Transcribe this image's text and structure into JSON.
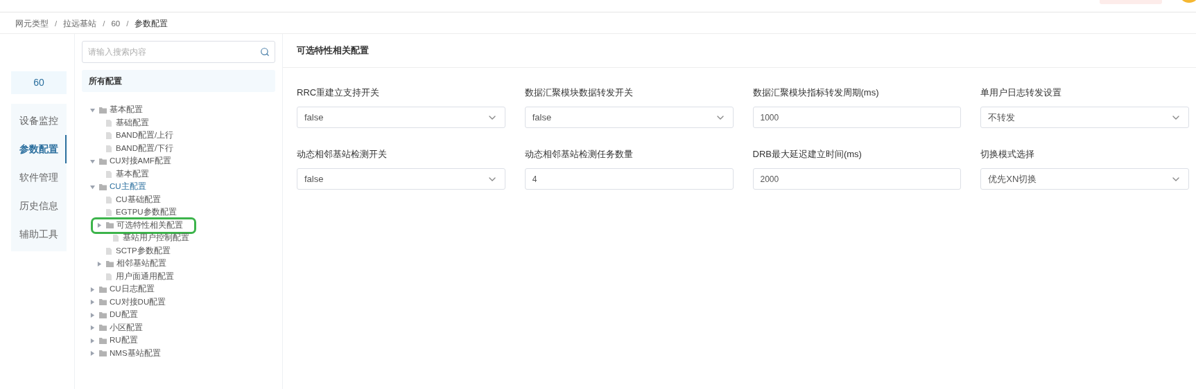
{
  "breadcrumb": [
    "网元类型",
    "拉远基站",
    "60",
    "参数配置"
  ],
  "breadcrumb_separator": "/",
  "nav": {
    "device": "60",
    "items": [
      {
        "label": "设备监控",
        "selected": false
      },
      {
        "label": "参数配置",
        "selected": true
      },
      {
        "label": "软件管理",
        "selected": false
      },
      {
        "label": "历史信息",
        "selected": false
      },
      {
        "label": "辅助工具",
        "selected": false
      }
    ]
  },
  "tree": {
    "search": {
      "placeholder": "请输入搜索内容"
    },
    "root": "所有配置",
    "items": [
      {
        "label": "基本配置",
        "kind": "folder",
        "expanded": true,
        "active": false,
        "highlighted": false,
        "children": [
          {
            "label": "基础配置",
            "kind": "file",
            "active": false,
            "highlighted": false
          },
          {
            "label": "BAND配置/上行",
            "kind": "file",
            "active": false,
            "highlighted": false
          },
          {
            "label": "BAND配置/下行",
            "kind": "file",
            "active": false,
            "highlighted": false
          }
        ]
      },
      {
        "label": "CU对接AMF配置",
        "kind": "folder",
        "expanded": true,
        "active": false,
        "highlighted": false,
        "children": [
          {
            "label": "基本配置",
            "kind": "file",
            "active": false,
            "highlighted": false
          }
        ]
      },
      {
        "label": "CU主配置",
        "kind": "folder",
        "expanded": true,
        "active": true,
        "highlighted": false,
        "children": [
          {
            "label": "CU基础配置",
            "kind": "file",
            "active": false,
            "highlighted": false
          },
          {
            "label": "EGTPU参数配置",
            "kind": "file",
            "active": false,
            "highlighted": false
          },
          {
            "label": "可选特性相关配置",
            "kind": "folder",
            "expanded": false,
            "active": false,
            "highlighted": true,
            "children": [
              {
                "label": "基站用户控制配置",
                "kind": "file",
                "active": false,
                "highlighted": false
              }
            ]
          },
          {
            "label": "SCTP参数配置",
            "kind": "file",
            "active": false,
            "highlighted": false
          },
          {
            "label": "相邻基站配置",
            "kind": "folder",
            "expanded": false,
            "active": false,
            "highlighted": false
          },
          {
            "label": "用户面通用配置",
            "kind": "file",
            "active": false,
            "highlighted": false
          }
        ]
      },
      {
        "label": "CU日志配置",
        "kind": "folder",
        "expanded": false,
        "active": false,
        "highlighted": false
      },
      {
        "label": "CU对接DU配置",
        "kind": "folder",
        "expanded": false,
        "active": false,
        "highlighted": false
      },
      {
        "label": "DU配置",
        "kind": "folder",
        "expanded": false,
        "active": false,
        "highlighted": false
      },
      {
        "label": "小区配置",
        "kind": "folder",
        "expanded": false,
        "active": false,
        "highlighted": false
      },
      {
        "label": "RU配置",
        "kind": "folder",
        "expanded": false,
        "active": false,
        "highlighted": false
      },
      {
        "label": "NMS基站配置",
        "kind": "folder",
        "expanded": false,
        "active": false,
        "highlighted": false
      }
    ]
  },
  "panel": {
    "title": "可选特性相关配置",
    "fields": [
      {
        "label": "RRC重建立支持开关",
        "kind": "select",
        "value": "false"
      },
      {
        "label": "数据汇聚模块数据转发开关",
        "kind": "select",
        "value": "false"
      },
      {
        "label": "数据汇聚模块指标转发周期(ms)",
        "kind": "input",
        "value": "1000"
      },
      {
        "label": "单用户日志转发设置",
        "kind": "select",
        "value": "不转发"
      },
      {
        "label": "动态相邻基站检测开关",
        "kind": "select",
        "value": "false"
      },
      {
        "label": "动态相邻基站检测任务数量",
        "kind": "input",
        "value": "4"
      },
      {
        "label": "DRB最大延迟建立时间(ms)",
        "kind": "input",
        "value": "2000"
      },
      {
        "label": "切换模式选择",
        "kind": "select",
        "value": "优先XN切换"
      }
    ]
  }
}
